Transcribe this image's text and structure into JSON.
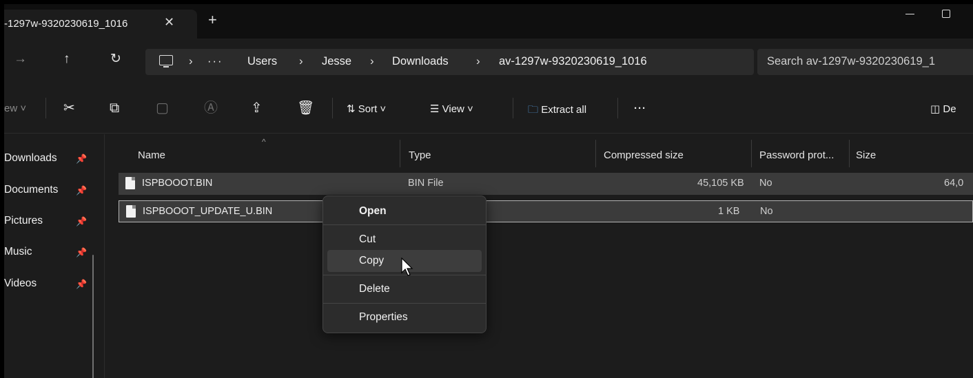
{
  "tab": {
    "title": "-1297w-9320230619_1016",
    "close_icon": "close-icon",
    "new_tab_icon": "plus-icon"
  },
  "window_controls": {
    "minimize": "minimize-icon",
    "maximize": "maximize-icon"
  },
  "nav": {
    "forward": "→",
    "up": "↑",
    "refresh": "↻"
  },
  "address": {
    "ellipsis": "···",
    "crumbs": [
      "Users",
      "Jesse",
      "Downloads",
      "av-1297w-9320230619_1016"
    ]
  },
  "search": {
    "placeholder": "Search av-1297w-9320230619_1"
  },
  "toolbar": {
    "new_label": "ew",
    "sort_label": "Sort",
    "view_label": "View",
    "extract_label": "Extract all",
    "more": "···",
    "details_label": "De"
  },
  "sidebar": {
    "items": [
      "Downloads",
      "Documents",
      "Pictures",
      "Music",
      "Videos"
    ]
  },
  "columns": [
    "Name",
    "Type",
    "Compressed size",
    "Password prot...",
    "Size"
  ],
  "files": [
    {
      "name": "ISPBOOOT.BIN",
      "type": "BIN File",
      "compressed": "45,105 KB",
      "password": "No",
      "size": "64,0"
    },
    {
      "name": "ISPBOOOT_UPDATE_U.BIN",
      "type": "",
      "compressed": "1 KB",
      "password": "No",
      "size": ""
    }
  ],
  "context_menu": {
    "open": "Open",
    "cut": "Cut",
    "copy": "Copy",
    "delete": "Delete",
    "properties": "Properties"
  }
}
